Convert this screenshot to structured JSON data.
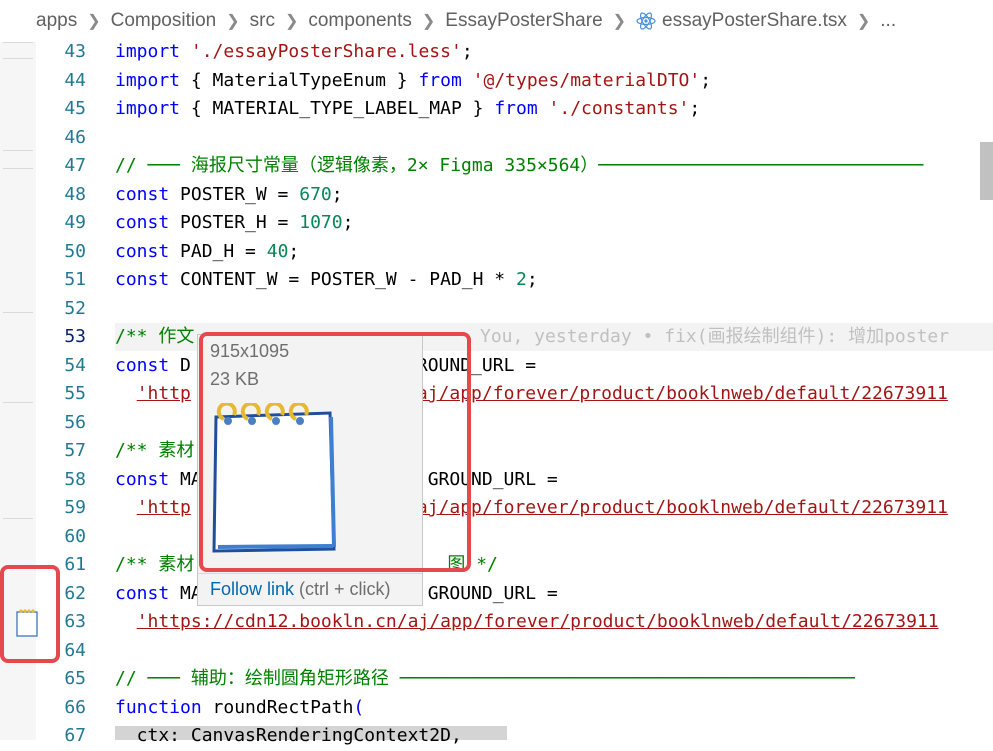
{
  "breadcrumb": {
    "items": [
      "apps",
      "Composition",
      "src",
      "components",
      "EssayPosterShare"
    ],
    "file": "essayPosterShare.tsx",
    "ellipsis": "..."
  },
  "colors": {
    "keyword": "#0000ff",
    "string": "#a31515",
    "number": "#098658",
    "comment": "#008000",
    "line_number": "#237893",
    "annotation": "#e5484d",
    "link": "#006ab1"
  },
  "editor": {
    "line_numbers": [
      "43",
      "44",
      "45",
      "46",
      "47",
      "48",
      "49",
      "50",
      "51",
      "52",
      "53",
      "54",
      "55",
      "56",
      "57",
      "58",
      "59",
      "60",
      "61",
      "62",
      "63",
      "64",
      "65",
      "66",
      "67"
    ],
    "current_line": "53",
    "blame": "You, yesterday • fix(画报绘制组件): 增加poster",
    "lines": {
      "l43": {
        "kw": "import",
        "str": "'./essayPosterShare.less'",
        "tail": ";"
      },
      "l44": {
        "kw1": "import",
        "mid": " { MaterialTypeEnum } ",
        "kw2": "from",
        "str": "'@/types/materialDTO'",
        "tail": ";"
      },
      "l45": {
        "kw1": "import",
        "mid": " { MATERIAL_TYPE_LABEL_MAP } ",
        "kw2": "from",
        "str": "'./constants'",
        "tail": ";"
      },
      "l47": "// ─── 海报尺寸常量（逻辑像素，2× Figma 335×564）──────────────────────────────",
      "l48": {
        "kw": "const",
        "name": " POSTER_W = ",
        "num": "670",
        "tail": ";"
      },
      "l49": {
        "kw": "const",
        "name": " POSTER_H = ",
        "num": "1070",
        "tail": ";"
      },
      "l50": {
        "kw": "const",
        "name": " PAD_H = ",
        "num": "40",
        "tail": ";"
      },
      "l51": {
        "kw": "const",
        "name": " CONTENT_W = POSTER_W - PAD_H * ",
        "num": "2",
        "tail": ";"
      },
      "l53": "/** 作文",
      "l54": {
        "kw": "const",
        "name": " D",
        "rest": "ROUND_URL ="
      },
      "l55": {
        "pre": "'http",
        "post": "aj/app/forever/product/booklnweb/default/22673911"
      },
      "l57": "/** 素材",
      "l58": {
        "kw": "const",
        "name": " MA",
        "rest": "GROUND_URL ="
      },
      "l59": {
        "pre": "'http",
        "post": "aj/app/forever/product/booklnweb/default/22673911"
      },
      "l61a": "/** 素材",
      "l61b": "图 */",
      "l62": {
        "kw": "const",
        "name": " MA",
        "rest": "GROUND_URL ="
      },
      "l63": "'https://cdn12.bookln.cn/aj/app/forever/product/booklnweb/default/22673911",
      "l65": "// ─── 辅助：绘制圆角矩形路径 ──────────────────────────────────────────",
      "l66": {
        "kw": "function",
        "name": " roundRectPath",
        "tail": "("
      },
      "l67": "  ctx: CanvasRenderingContext2D,"
    }
  },
  "hover": {
    "dimensions": "915x1095",
    "size": "23 KB",
    "follow_link": "Follow link",
    "shortcut": " (ctrl + click)"
  }
}
